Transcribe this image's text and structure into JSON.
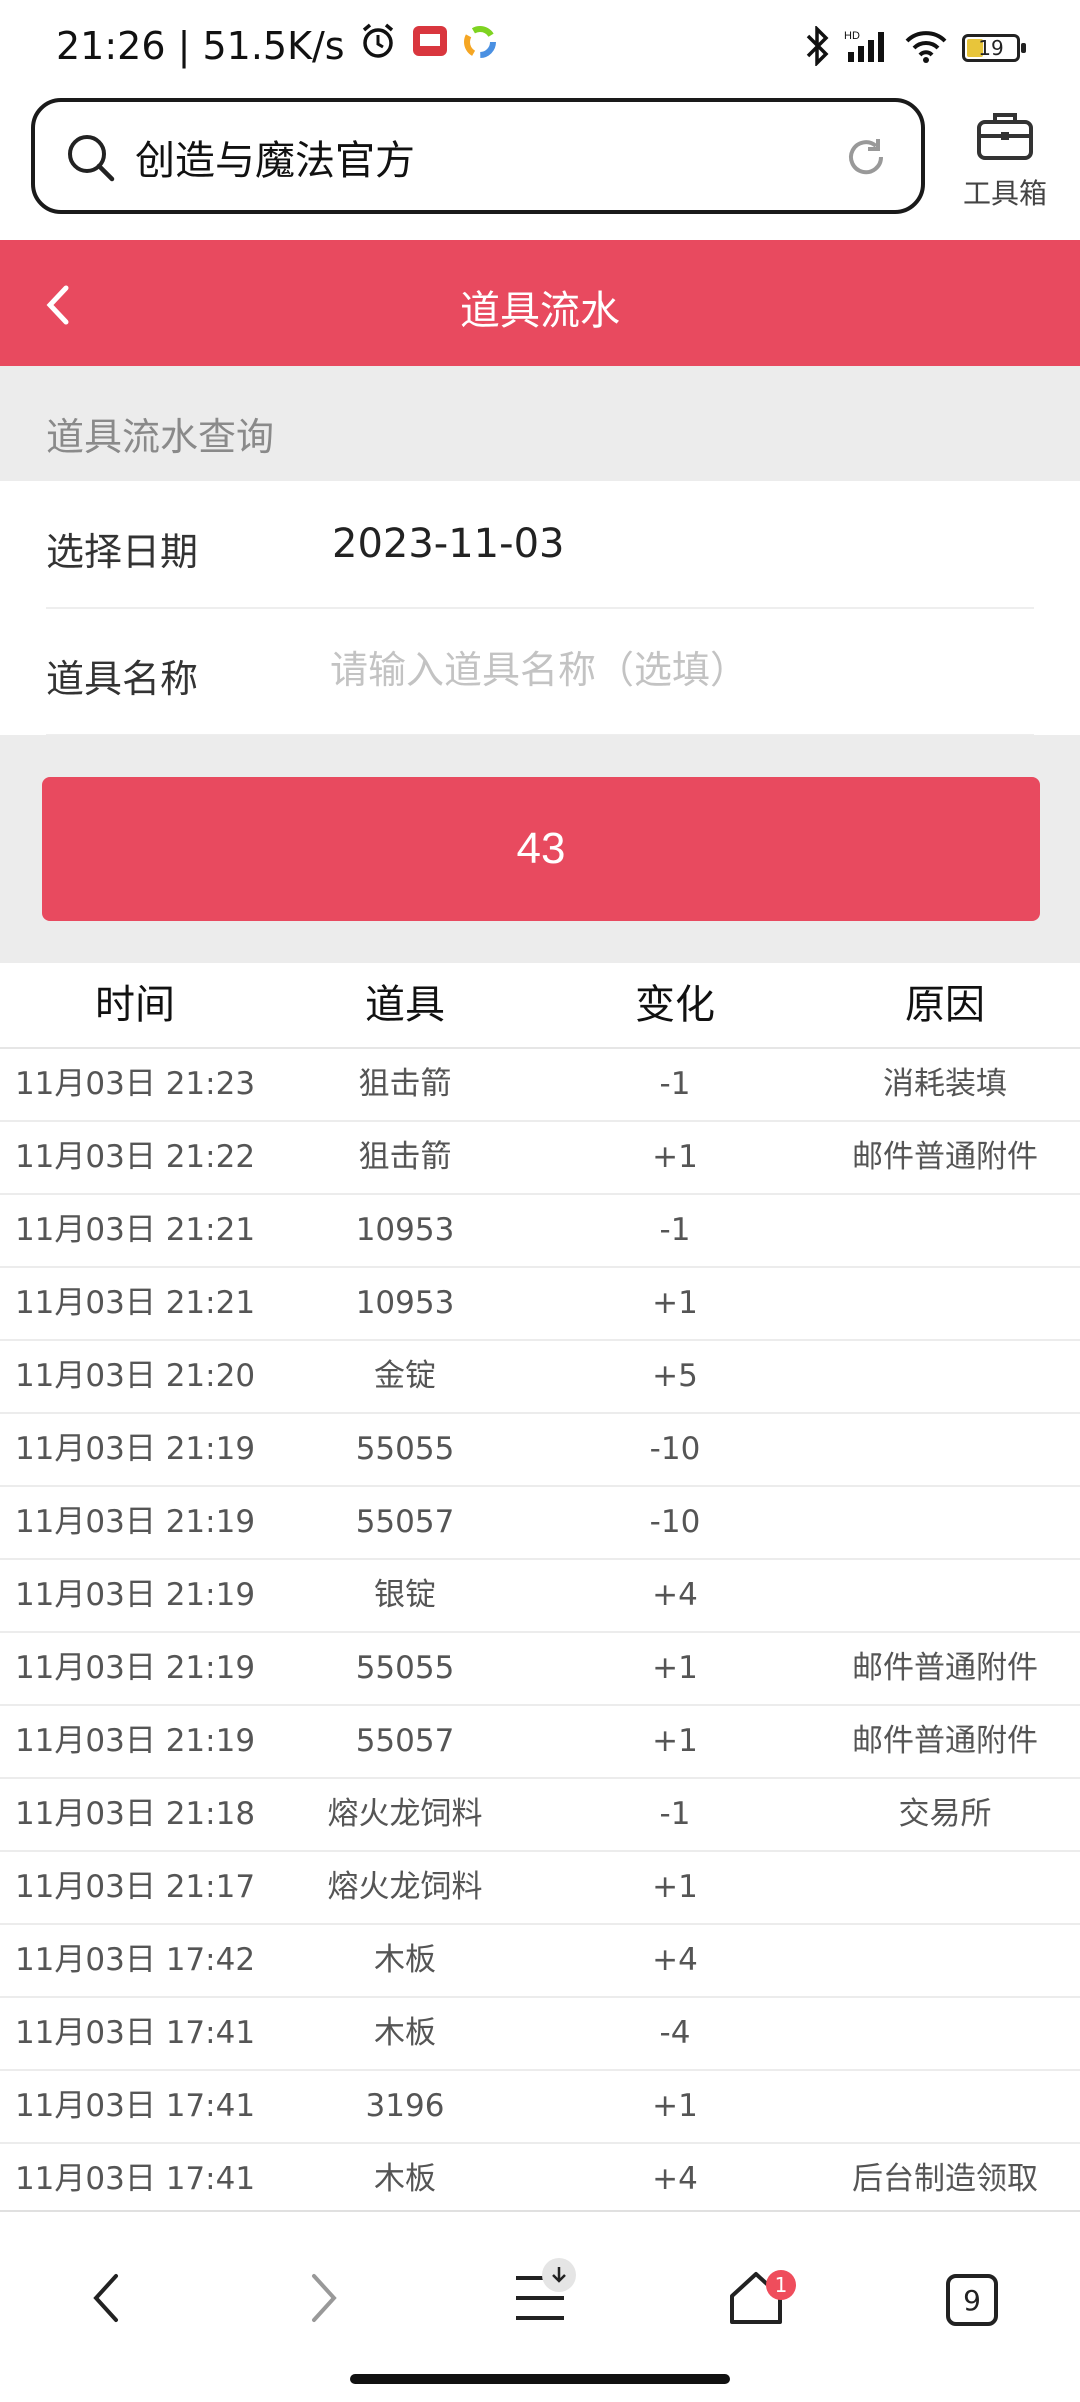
{
  "status_bar": {
    "time_speed": "21:26 | 51.5K/s",
    "battery": "19"
  },
  "search": {
    "query": "创造与魔法官方"
  },
  "toolbox": {
    "label": "工具箱"
  },
  "header": {
    "title": "道具流水"
  },
  "query_section": {
    "title": "道具流水查询"
  },
  "form": {
    "date_label": "选择日期",
    "date_value": "2023-11-03",
    "item_label": "道具名称",
    "item_placeholder": "请输入道具名称（选填）"
  },
  "count_button": {
    "label": "43"
  },
  "table": {
    "headers": [
      "时间",
      "道具",
      "变化",
      "原因"
    ],
    "rows": [
      [
        "11月03日 21:23",
        "狙击箭",
        "-1",
        "消耗装填"
      ],
      [
        "11月03日 21:22",
        "狙击箭",
        "+1",
        "邮件普通附件"
      ],
      [
        "11月03日 21:21",
        "10953",
        "-1",
        ""
      ],
      [
        "11月03日 21:21",
        "10953",
        "+1",
        ""
      ],
      [
        "11月03日 21:20",
        "金锭",
        "+5",
        ""
      ],
      [
        "11月03日 21:19",
        "55055",
        "-10",
        ""
      ],
      [
        "11月03日 21:19",
        "55057",
        "-10",
        ""
      ],
      [
        "11月03日 21:19",
        "银锭",
        "+4",
        ""
      ],
      [
        "11月03日 21:19",
        "55055",
        "+1",
        "邮件普通附件"
      ],
      [
        "11月03日 21:19",
        "55057",
        "+1",
        "邮件普通附件"
      ],
      [
        "11月03日 21:18",
        "熔火龙饲料",
        "-1",
        "交易所"
      ],
      [
        "11月03日 21:17",
        "熔火龙饲料",
        "+1",
        ""
      ],
      [
        "11月03日 17:42",
        "木板",
        "+4",
        ""
      ],
      [
        "11月03日 17:41",
        "木板",
        "-4",
        ""
      ],
      [
        "11月03日 17:41",
        "3196",
        "+1",
        ""
      ],
      [
        "11月03日 17:41",
        "木板",
        "+4",
        "后台制造领取"
      ]
    ]
  },
  "bottom_nav": {
    "home_badge": "1",
    "tabs_count": "9"
  },
  "colors": {
    "accent": "#e84a5f",
    "section_bg": "#ececec"
  }
}
